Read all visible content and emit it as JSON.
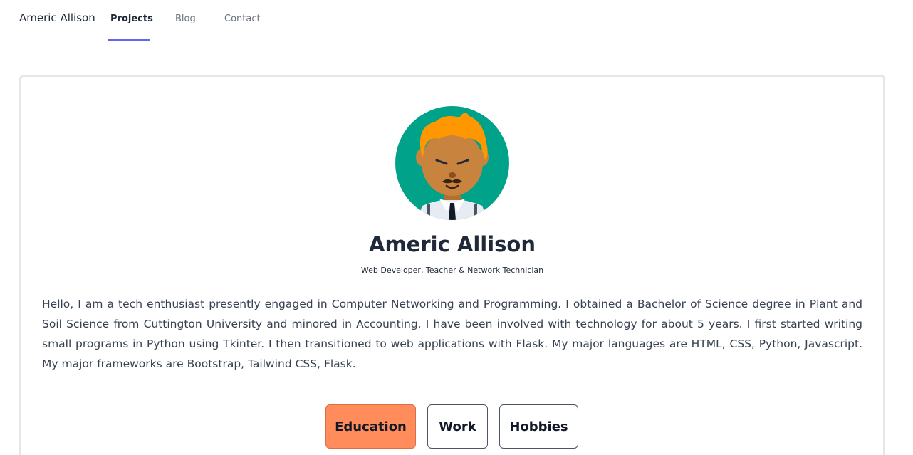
{
  "nav": {
    "brand": "Americ Allison",
    "links": [
      {
        "label": "Projects",
        "active": true
      },
      {
        "label": "Blog",
        "active": false
      },
      {
        "label": "Contact",
        "active": false
      }
    ],
    "accent_color": "#6366f1"
  },
  "profile": {
    "avatar_icon": "cartoon-man-avatar-icon",
    "name": "Americ Allison",
    "subtitle": "Web Developer, Teacher & Network Technician",
    "bio": "Hello, I am a tech enthusiast presently engaged in Computer Networking and Programming. I obtained a Bachelor of Science degree in Plant and Soil Science from Cuttington University and minored in Accounting. I have been involved with technology for about 5 years. I first started writing small programs in Python using Tkinter. I then transitioned to web applications with Flask. My major languages are HTML, CSS, Python, Javascript. My major frameworks are Bootstrap, Tailwind CSS, Flask."
  },
  "tabs": [
    {
      "label": "Education",
      "active": true
    },
    {
      "label": "Work",
      "active": false
    },
    {
      "label": "Hobbies",
      "active": false
    }
  ],
  "colors": {
    "active_tab": "#ff8c5a",
    "avatar_bg": "#00a28a",
    "hair": "#ff9800",
    "skin": "#c8843e"
  }
}
